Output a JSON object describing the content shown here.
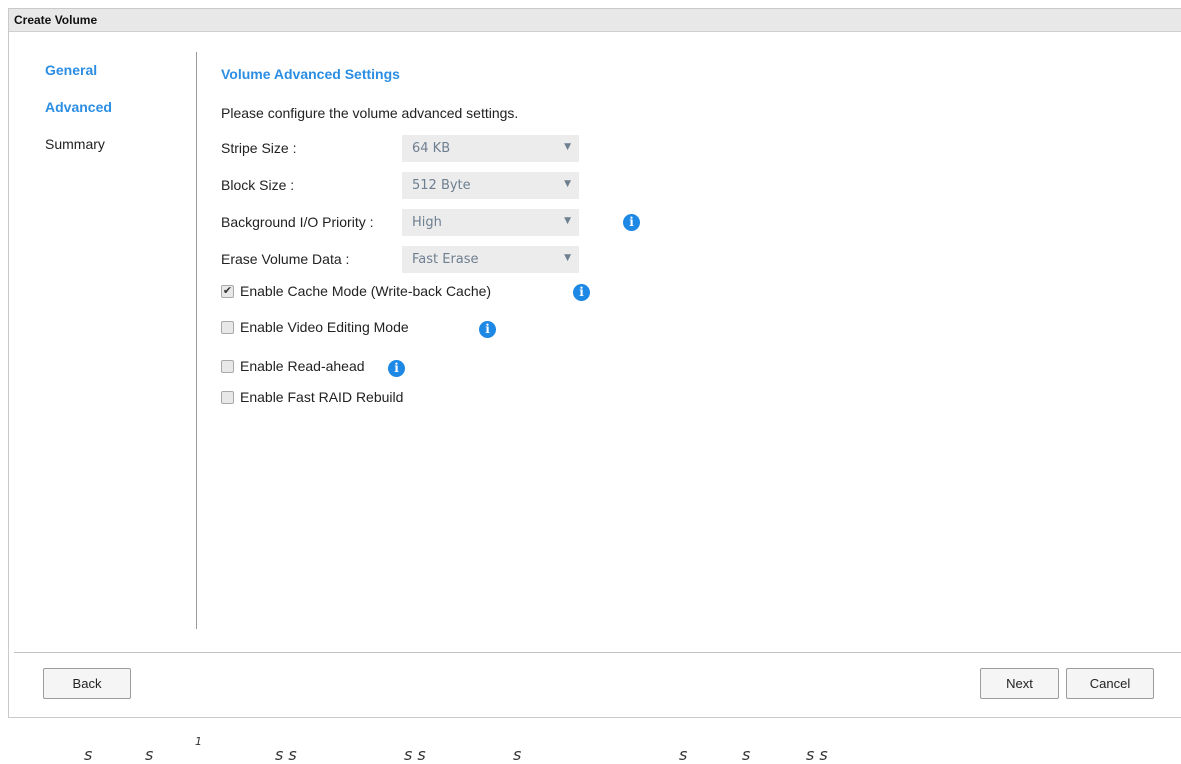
{
  "window": {
    "title": "Create Volume"
  },
  "steps": [
    {
      "label": "General"
    },
    {
      "label": "Advanced"
    },
    {
      "label": "Summary"
    }
  ],
  "section": {
    "title": "Volume Advanced Settings",
    "description": "Please configure the volume advanced settings."
  },
  "settings": {
    "stripe_size": {
      "label": "Stripe Size :",
      "value": "64 KB"
    },
    "block_size": {
      "label": "Block Size :",
      "value": "512 Byte"
    },
    "bg_io_priority": {
      "label": "Background I/O Priority :",
      "value": "High"
    },
    "erase_volume_data": {
      "label": "Erase Volume Data :",
      "value": "Fast Erase"
    }
  },
  "options": {
    "cache_mode": {
      "label": "Enable Cache Mode (Write-back Cache)",
      "checked": true
    },
    "video_editing": {
      "label": "Enable Video Editing Mode",
      "checked": false
    },
    "read_ahead": {
      "label": "Enable Read-ahead",
      "checked": false
    },
    "fast_raid_rebuild": {
      "label": "Enable Fast RAID Rebuild",
      "checked": false
    }
  },
  "buttons": {
    "back": "Back",
    "next": "Next",
    "cancel": "Cancel"
  },
  "footer_fragments": [
    "s",
    "s",
    "1",
    "s s",
    "s s",
    "s",
    "s",
    "s",
    "s s"
  ],
  "colors": {
    "accent": "#2b8ee3",
    "info_icon": "#1e88e5"
  }
}
